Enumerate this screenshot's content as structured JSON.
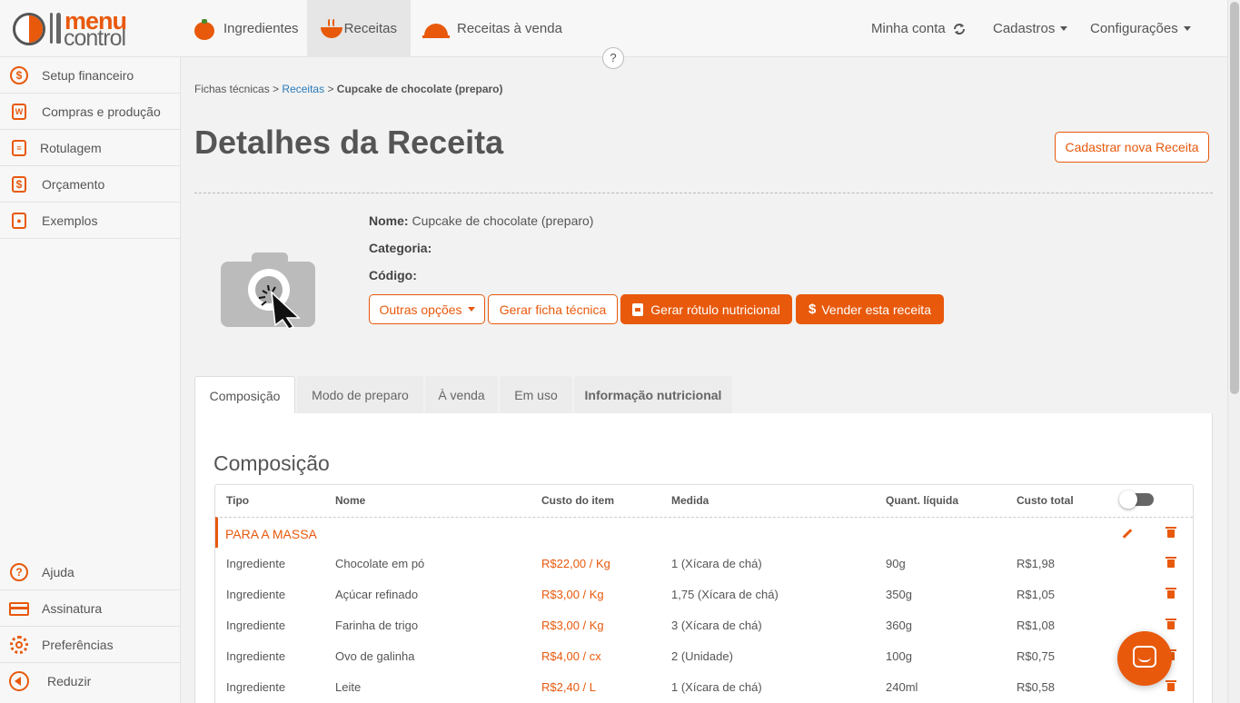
{
  "brand": {
    "word1": "menu",
    "word2": "control",
    "accent_color": "#e8590c"
  },
  "topnav": {
    "items": [
      {
        "label": "Ingredientes",
        "icon": "tomato-icon"
      },
      {
        "label": "Receitas",
        "icon": "bowl-icon",
        "active": true
      },
      {
        "label": "Receitas à venda",
        "icon": "cloche-icon"
      }
    ],
    "account": "Minha conta",
    "cadastros": "Cadastros",
    "configuracoes": "Configurações",
    "help": "?"
  },
  "sidebar": {
    "items": [
      {
        "label": "Setup financeiro",
        "icon": "gear-dollar-icon"
      },
      {
        "label": "Compras e produção",
        "icon": "clipboard-icon"
      },
      {
        "label": "Rotulagem",
        "icon": "label-jar-icon"
      },
      {
        "label": "Orçamento",
        "icon": "dollar-doc-icon"
      },
      {
        "label": "Exemplos",
        "icon": "recipe-book-icon"
      }
    ],
    "bottom": [
      {
        "label": "Ajuda",
        "icon": "help-icon"
      },
      {
        "label": "Assinatura",
        "icon": "credit-card-icon"
      },
      {
        "label": "Preferências",
        "icon": "gear-icon"
      }
    ],
    "collapse": "Reduzir"
  },
  "breadcrumb": {
    "root": "Fichas técnicas",
    "sep": ">",
    "link": "Receitas",
    "current": "Cupcake de chocolate (preparo)"
  },
  "page": {
    "title": "Detalhes da Receita",
    "new_button": "Cadastrar nova Receita"
  },
  "recipe": {
    "name_label": "Nome:",
    "name_value": "Cupcake de chocolate (preparo)",
    "category_label": "Categoria:",
    "category_value": "",
    "code_label": "Código:",
    "code_value": ""
  },
  "actions": {
    "other_options": "Outras opções",
    "generate_sheet": "Gerar ficha técnica",
    "generate_label": "Gerar rótulo nutricional",
    "sell": "Vender esta receita",
    "sell_prefix": "$"
  },
  "tabs": [
    "Composição",
    "Modo de preparo",
    "À venda",
    "Em uso",
    "Informação nutricional"
  ],
  "composition": {
    "title": "Composição",
    "columns": [
      "Tipo",
      "Nome",
      "Custo do item",
      "Medida",
      "Quant. líquida",
      "Custo total"
    ],
    "group": "PARA A MASSA",
    "rows": [
      {
        "tipo": "Ingrediente",
        "nome": "Chocolate em pó",
        "custo": "R$22,00 / Kg",
        "medida": "1 (Xícara de chá)",
        "quant": "90g",
        "total": "R$1,98"
      },
      {
        "tipo": "Ingrediente",
        "nome": "Açúcar refinado",
        "custo": "R$3,00 / Kg",
        "medida": "1,75 (Xícara de chá)",
        "quant": "350g",
        "total": "R$1,05"
      },
      {
        "tipo": "Ingrediente",
        "nome": "Farinha de trigo",
        "custo": "R$3,00 / Kg",
        "medida": "3 (Xícara de chá)",
        "quant": "360g",
        "total": "R$1,08"
      },
      {
        "tipo": "Ingrediente",
        "nome": "Ovo de galinha",
        "custo": "R$4,00 / cx",
        "medida": "2 (Unidade)",
        "quant": "100g",
        "total": "R$0,75"
      },
      {
        "tipo": "Ingrediente",
        "nome": "Leite",
        "custo": "R$2,40 / L",
        "medida": "1 (Xícara de chá)",
        "quant": "240ml",
        "total": "R$0,58"
      }
    ]
  }
}
